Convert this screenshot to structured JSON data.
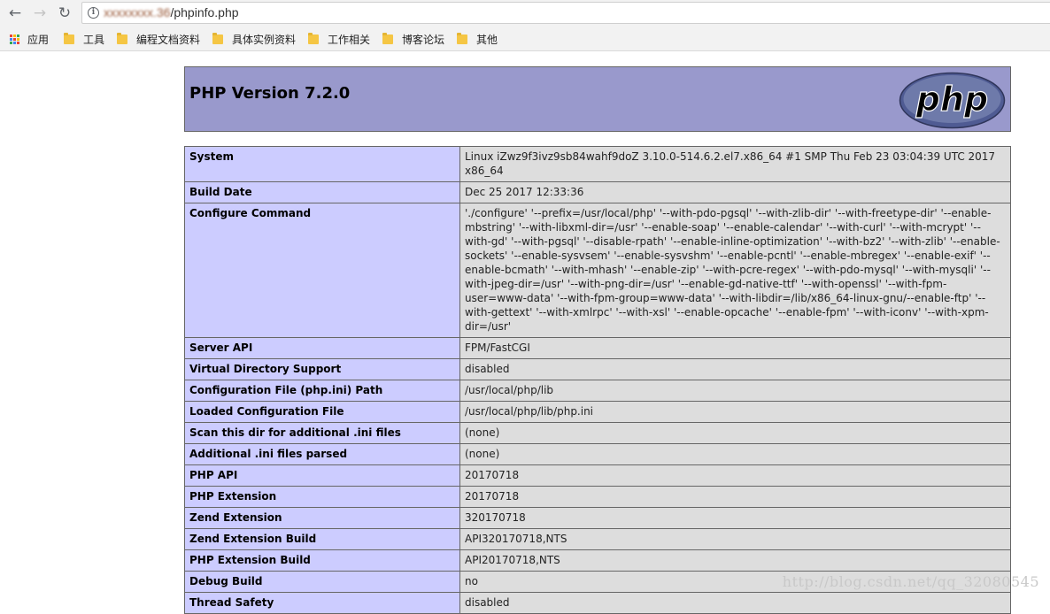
{
  "browser": {
    "url_host": "xxxxxxxx.36",
    "url_path": "/phpinfo.php",
    "bookmarks": {
      "apps": "应用",
      "items": [
        "工具",
        "编程文档资料",
        "具体实例资料",
        "工作相关",
        "博客论坛",
        "其他"
      ]
    }
  },
  "page": {
    "title": "PHP Version 7.2.0",
    "logo_text": "php"
  },
  "info_rows": [
    {
      "key": "System",
      "value": "Linux iZwz9f3ivz9sb84wahf9doZ 3.10.0-514.6.2.el7.x86_64 #1 SMP Thu Feb 23 03:04:39 UTC 2017 x86_64"
    },
    {
      "key": "Build Date",
      "value": "Dec 25 2017 12:33:36"
    },
    {
      "key": "Configure Command",
      "value": "'./configure' '--prefix=/usr/local/php' '--with-pdo-pgsql' '--with-zlib-dir' '--with-freetype-dir' '--enable-mbstring' '--with-libxml-dir=/usr' '--enable-soap' '--enable-calendar' '--with-curl' '--with-mcrypt' '--with-gd' '--with-pgsql' '--disable-rpath' '--enable-inline-optimization' '--with-bz2' '--with-zlib' '--enable-sockets' '--enable-sysvsem' '--enable-sysvshm' '--enable-pcntl' '--enable-mbregex' '--enable-exif' '--enable-bcmath' '--with-mhash' '--enable-zip' '--with-pcre-regex' '--with-pdo-mysql' '--with-mysqli' '--with-jpeg-dir=/usr' '--with-png-dir=/usr' '--enable-gd-native-ttf' '--with-openssl' '--with-fpm-user=www-data' '--with-fpm-group=www-data' '--with-libdir=/lib/x86_64-linux-gnu/--enable-ftp' '--with-gettext' '--with-xmlrpc' '--with-xsl' '--enable-opcache' '--enable-fpm' '--with-iconv' '--with-xpm-dir=/usr'"
    },
    {
      "key": "Server API",
      "value": "FPM/FastCGI"
    },
    {
      "key": "Virtual Directory Support",
      "value": "disabled"
    },
    {
      "key": "Configuration File (php.ini) Path",
      "value": "/usr/local/php/lib"
    },
    {
      "key": "Loaded Configuration File",
      "value": "/usr/local/php/lib/php.ini"
    },
    {
      "key": "Scan this dir for additional .ini files",
      "value": "(none)"
    },
    {
      "key": "Additional .ini files parsed",
      "value": "(none)"
    },
    {
      "key": "PHP API",
      "value": "20170718"
    },
    {
      "key": "PHP Extension",
      "value": "20170718"
    },
    {
      "key": "Zend Extension",
      "value": "320170718"
    },
    {
      "key": "Zend Extension Build",
      "value": "API320170718,NTS"
    },
    {
      "key": "PHP Extension Build",
      "value": "API20170718,NTS"
    },
    {
      "key": "Debug Build",
      "value": "no"
    },
    {
      "key": "Thread Safety",
      "value": "disabled"
    }
  ],
  "watermark": "http://blog.csdn.net/qq_32080545",
  "colors": {
    "header_bg": "#9999cc",
    "key_bg": "#ccccff",
    "value_bg": "#dddddd",
    "logo_bg": "#6c7eb7"
  }
}
